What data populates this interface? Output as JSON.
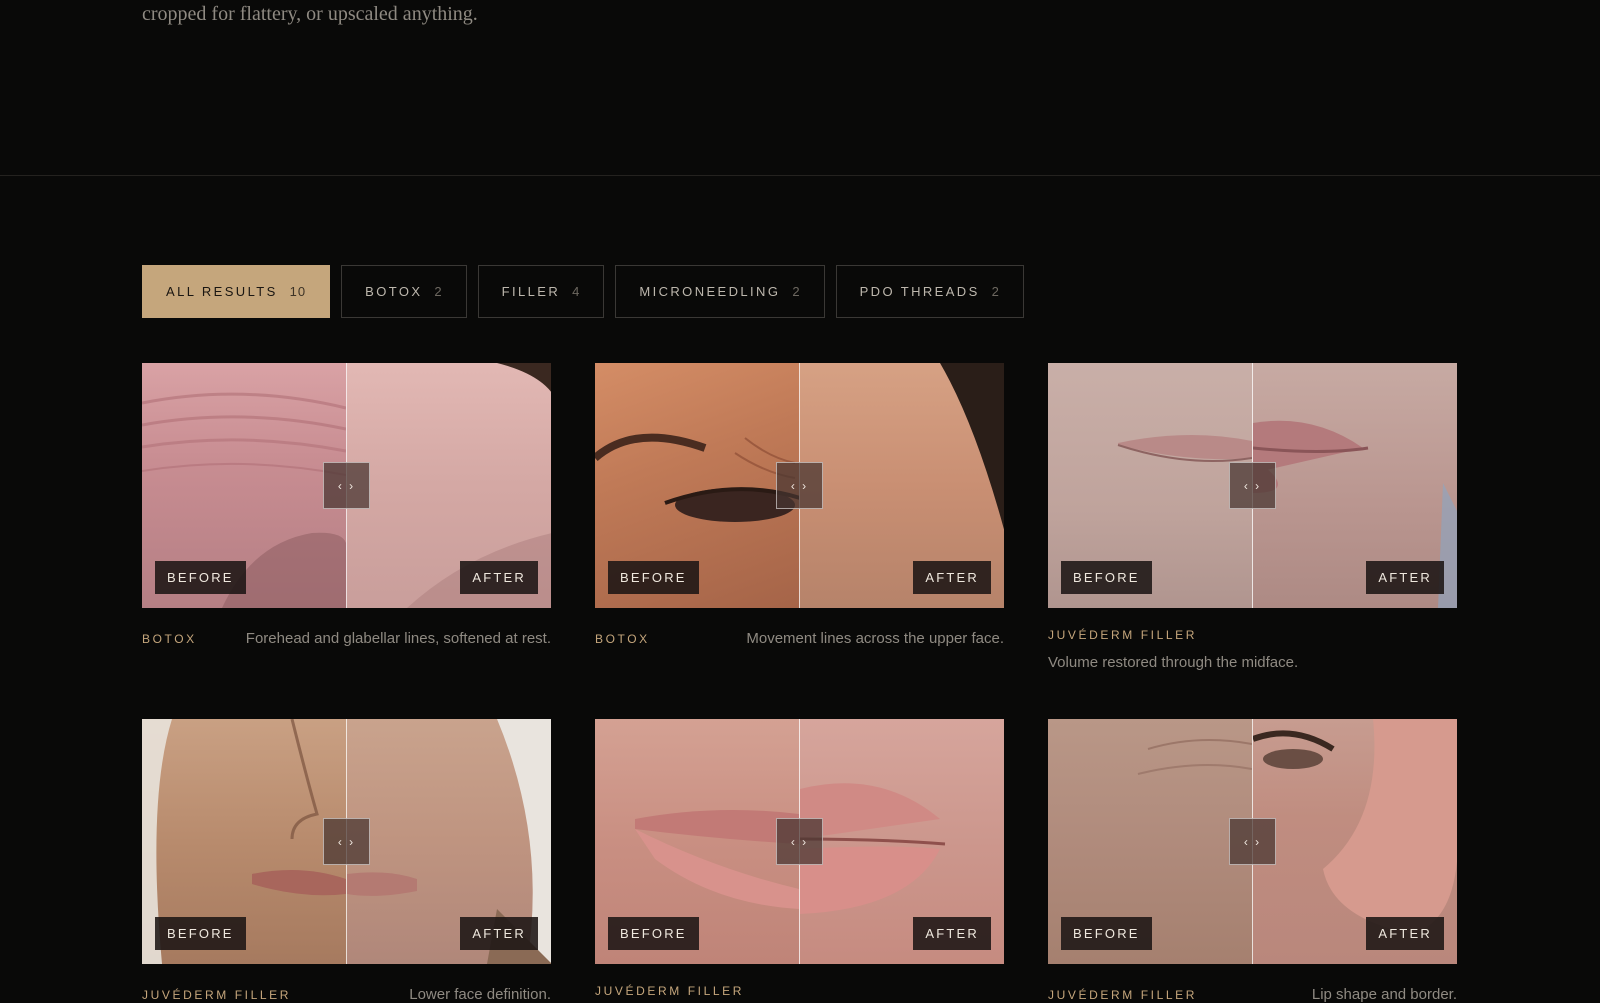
{
  "intro": {
    "text": "cropped for flattery, or upscaled anything."
  },
  "filters": [
    {
      "label": "ALL RESULTS",
      "count": "10",
      "active": true
    },
    {
      "label": "BOTOX",
      "count": "2"
    },
    {
      "label": "FILLER",
      "count": "4"
    },
    {
      "label": "MICRONEEDLING",
      "count": "2"
    },
    {
      "label": "PDO THREADS",
      "count": "2"
    }
  ],
  "compare": {
    "handle": "‹ ›",
    "before": "BEFORE",
    "after": "AFTER"
  },
  "results": [
    {
      "category": "BOTOX",
      "description": "Forehead and glabellar lines, softened at rest."
    },
    {
      "category": "BOTOX",
      "description": "Movement lines across the upper face."
    },
    {
      "category": "JUVÉDERM FILLER",
      "description": "Volume restored through the midface."
    },
    {
      "category": "JUVÉDERM FILLER",
      "description": "Lower face definition."
    },
    {
      "category": "JUVÉDERM FILLER",
      "description": ""
    },
    {
      "category": "JUVÉDERM FILLER",
      "description": "Lip shape and border."
    }
  ]
}
